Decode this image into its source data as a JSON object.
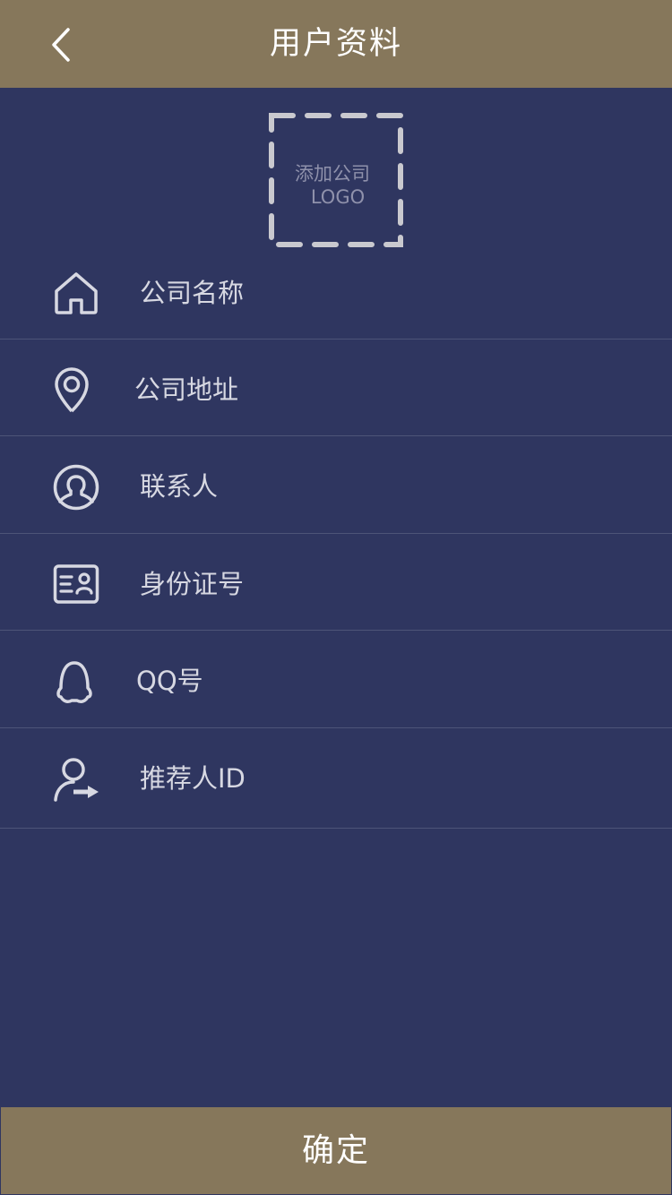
{
  "header": {
    "title": "用户资料",
    "back_icon": "chevron-left-icon"
  },
  "logo_upload": {
    "line1": "添加公司",
    "line2": "LOGO"
  },
  "form": {
    "items": [
      {
        "icon": "home-icon",
        "label": "公司名称"
      },
      {
        "icon": "location-pin-icon",
        "label": "公司地址"
      },
      {
        "icon": "contact-person-icon",
        "label": "联系人"
      },
      {
        "icon": "id-card-icon",
        "label": "身份证号"
      },
      {
        "icon": "qq-icon",
        "label": "QQ号"
      },
      {
        "icon": "referrer-icon",
        "label": "推荐人ID"
      }
    ]
  },
  "footer": {
    "confirm_label": "确定"
  },
  "colors": {
    "header_bg": "#86775b",
    "page_bg": "#2f3660",
    "divider": "#4d5478",
    "text": "#d7d8e2"
  }
}
